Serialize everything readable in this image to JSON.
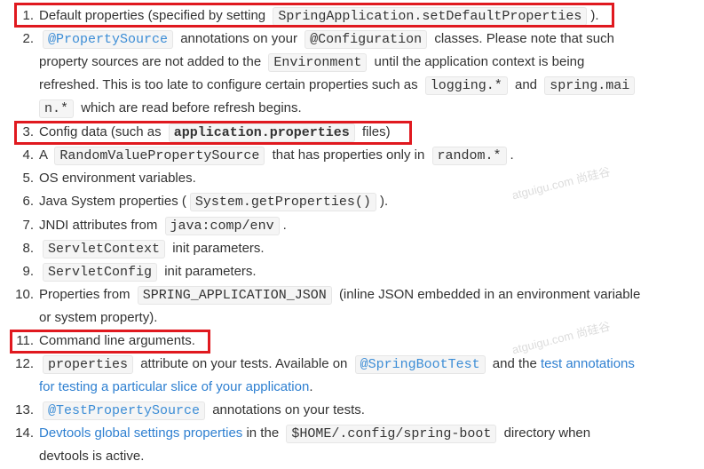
{
  "items": [
    {
      "num": "1.",
      "lines": [
        [
          "Default properties (specified by setting ",
          "SpringApplication.setDefaultProperties",
          ")."
        ]
      ]
    },
    {
      "num": "2.",
      "code1": "@PropertySource",
      "t1": "annotations on your",
      "code2": "@Configuration",
      "t2": "classes. Please note that such",
      "line2a": "property sources are not added to the",
      "code3": "Environment",
      "line2b": "until the application context is being",
      "line3a": "refreshed. This is too late to configure certain properties such as",
      "code4": "logging.*",
      "line3b": "and",
      "code5a": "spring.mai",
      "code5b": "n.*",
      "line4": "which are read before refresh begins."
    },
    {
      "num": "3.",
      "pre": "Config data (such as",
      "code": "application.properties",
      "post": "files)"
    },
    {
      "num": "4.",
      "pre": "A",
      "code1": "RandomValuePropertySource",
      "mid": "that has properties only in",
      "code2": "random.*",
      "post": "."
    },
    {
      "num": "5.",
      "text": "OS environment variables."
    },
    {
      "num": "6.",
      "pre": "Java System properties (",
      "code": "System.getProperties()",
      "post": ")."
    },
    {
      "num": "7.",
      "pre": "JNDI attributes from",
      "code": "java:comp/env",
      "post": "."
    },
    {
      "num": "8.",
      "code": "ServletContext",
      "post": "init parameters."
    },
    {
      "num": "9.",
      "code": "ServletConfig",
      "post": "init parameters."
    },
    {
      "num": "10.",
      "pre": "Properties from",
      "code": "SPRING_APPLICATION_JSON",
      "post": "(inline JSON embedded in an environment variable",
      "line2": "or system property)."
    },
    {
      "num": "11.",
      "text": "Command line arguments."
    },
    {
      "num": "12.",
      "code1": "properties",
      "mid": "attribute on your tests. Available on",
      "code2": "@SpringBootTest",
      "and": "and the",
      "link1": "test annotations",
      "link2": "for testing a particular slice of your application",
      "post": "."
    },
    {
      "num": "13.",
      "code": "@TestPropertySource",
      "post": "annotations on your tests."
    },
    {
      "num": "14.",
      "link": "Devtools global settings properties",
      "mid": "in the",
      "code": "$HOME/.config/spring-boot",
      "post": "directory when",
      "line2": "devtools is active."
    }
  ],
  "watermark": "atguigu.com 尚硅谷",
  "colors": {
    "highlight_box": "#e0191f",
    "link": "#2f80d1"
  }
}
